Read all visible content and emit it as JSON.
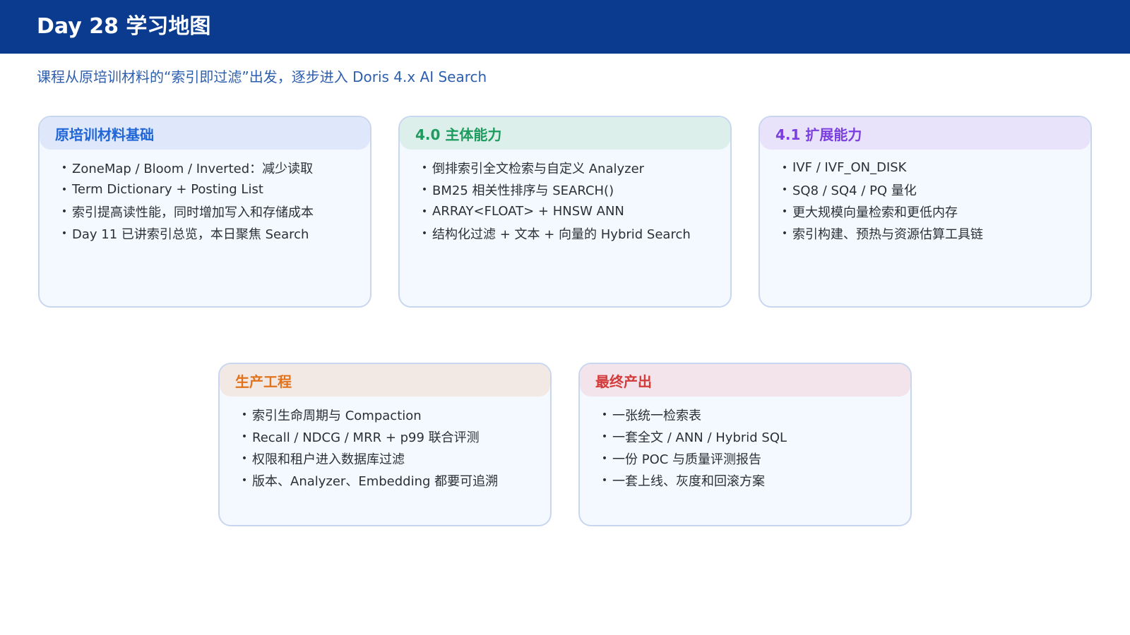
{
  "header": {
    "title": "Day 28 学习地图",
    "subtitle": "课程从原培训材料的“索引即过滤”出发，逐步进入 Doris 4.x AI Search"
  },
  "cards": [
    {
      "title": "原培训材料基础",
      "title_color": "#2166d6",
      "head_bg": "#dfe8fb",
      "items": [
        "ZoneMap / Bloom / Inverted：减少读取",
        "Term Dictionary + Posting List",
        "索引提高读性能，同时增加写入和存储成本",
        "Day 11 已讲索引总览，本日聚焦 Search"
      ]
    },
    {
      "title": "4.0 主体能力",
      "title_color": "#1e9b5e",
      "head_bg": "#dcefea",
      "items": [
        "倒排索引全文检索与自定义 Analyzer",
        "BM25 相关性排序与 SEARCH()",
        "ARRAY<FLOAT> + HNSW ANN",
        "结构化过滤 + 文本 + 向量的 Hybrid Search"
      ]
    },
    {
      "title": "4.1 扩展能力",
      "title_color": "#7b3fe0",
      "head_bg": "#e8e2fb",
      "items": [
        "IVF / IVF_ON_DISK",
        "SQ8 / SQ4 / PQ 量化",
        "更大规模向量检索和更低内存",
        "索引构建、预热与资源估算工具链"
      ]
    },
    {
      "title": "生产工程",
      "title_color": "#e0731e",
      "head_bg": "#f3e9e4",
      "items": [
        "索引生命周期与 Compaction",
        "Recall / NDCG / MRR + p99 联合评测",
        "权限和租户进入数据库过滤",
        "版本、Analyzer、Embedding 都要可追溯"
      ]
    },
    {
      "title": "最终产出",
      "title_color": "#d33b3b",
      "head_bg": "#f3e3ea",
      "items": [
        "一张统一检索表",
        "一套全文 / ANN / Hybrid SQL",
        "一份 POC 与质量评测报告",
        "一套上线、灰度和回滚方案"
      ]
    }
  ]
}
